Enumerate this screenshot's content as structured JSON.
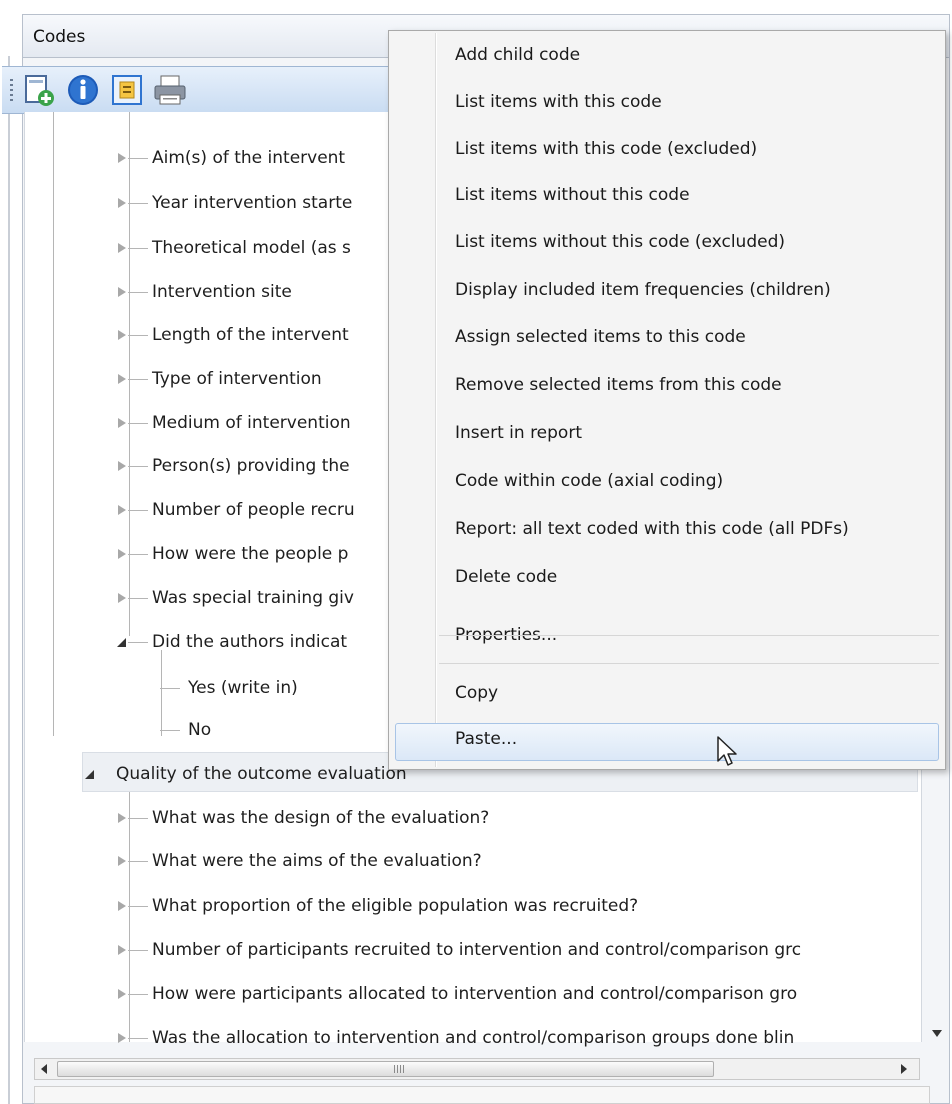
{
  "panel": {
    "title": "Codes"
  },
  "toolbar": {
    "buttons": [
      {
        "icon": "add-code-icon"
      },
      {
        "icon": "info-icon"
      },
      {
        "icon": "code-properties-icon"
      },
      {
        "icon": "print-icon"
      }
    ]
  },
  "tree": {
    "group1_children": [
      "Aim(s) of the intervent",
      "Year intervention starte",
      "Theoretical model (as s",
      "Intervention site",
      "Length of the intervent",
      "Type of intervention",
      "Medium of intervention",
      "Person(s) providing the",
      "Number of people recru",
      "How were the people p",
      "Was special training giv",
      "Did the authors indicat"
    ],
    "expanded_children": [
      "Yes (write in)",
      "No"
    ],
    "section_label": "Quality of the outcome evaluation",
    "section_children": [
      "What was the design of the evaluation?",
      "What were the aims of the evaluation?",
      "What proportion of the eligible population was recruited?",
      "Number of participants recruited to intervention and control/comparison grc",
      "How were participants allocated to intervention and control/comparison gro",
      "Was the allocation to intervention and control/comparison groups done blin"
    ]
  },
  "hscroll": {
    "thumb_fraction": 0.78
  },
  "context_menu": {
    "items": [
      "Add child code",
      "List items with this code",
      "List items with this code (excluded)",
      "List items without this code",
      "List items without this code (excluded)",
      "Display included item frequencies (children)",
      "Assign selected items to this code",
      "Remove selected items from this code",
      "Insert in report",
      "Code within code (axial coding)",
      "Report: all text coded with this code (all PDFs)",
      "Delete code",
      "Properties...",
      "Copy",
      "Paste..."
    ],
    "highlighted": "Paste..."
  }
}
